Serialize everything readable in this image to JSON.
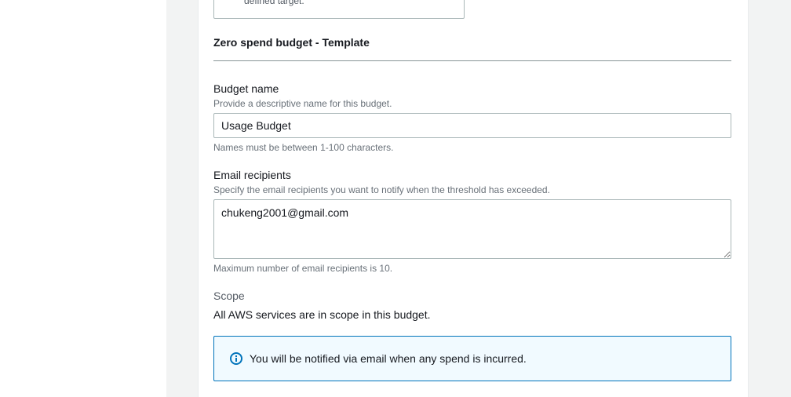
{
  "previous_card": {
    "text": "defined target."
  },
  "section": {
    "title": "Zero spend budget - Template"
  },
  "budget_name": {
    "label": "Budget name",
    "description": "Provide a descriptive name for this budget.",
    "value": "Usage Budget",
    "constraint": "Names must be between 1-100 characters."
  },
  "email_recipients": {
    "label": "Email recipients",
    "description": "Specify the email recipients you want to notify when the threshold has exceeded.",
    "value": "chukeng2001@gmail.com",
    "constraint": "Maximum number of email recipients is 10."
  },
  "scope": {
    "label": "Scope",
    "text": "All AWS services are in scope in this budget."
  },
  "info_alert": {
    "icon": "info-icon",
    "text": "You will be notified via email when any spend is incurred.",
    "accent_color": "#0073bb"
  }
}
